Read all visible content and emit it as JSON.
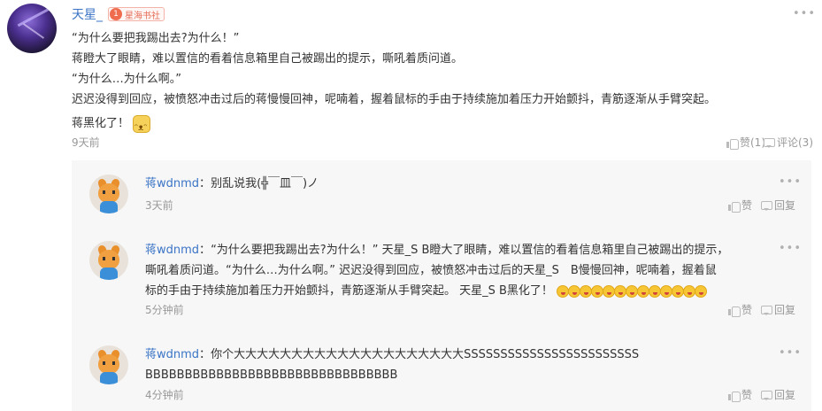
{
  "post": {
    "user_name": "天星_",
    "group_badge_num": "1",
    "group_badge_label": "星海书社",
    "lines": [
      "“为什么要把我踢出去?为什么！”",
      "蒋瞪大了眼睛，难以置信的看着信息箱里自己被踢出的提示，嘶吼着质问道。",
      "“为什么…为什么啊。”",
      "迟迟没得到回应，被愤怒冲击过后的蒋慢慢回神，呢喃着，握着鼠标的手由于持续施加着压力开始颤抖，青筋逐渐从手臂突起。",
      "蒋黑化了！"
    ],
    "time": "9天前",
    "like_label": "赞(1)",
    "comment_label": "评论(3)",
    "more_label": "•••"
  },
  "replies": [
    {
      "name": "蒋wdnmd",
      "lines": [
        "别乱说我(╬￣皿￣)ノ"
      ],
      "time": "3天前",
      "like_label": "赞",
      "reply_label": "回复",
      "more_label": "•••"
    },
    {
      "name": "蒋wdnmd",
      "lines": [
        "“为什么要把我踢出去?为什么！” 天星_S B瞪大了眼睛，难以置信的看着信息箱里自己被踢出的提示，",
        "嘶吼着质问道。“为什么…为什么啊。” 迟迟没得到回应，被愤怒冲击过后的天星_S　B慢慢回神，呢喃着，握着鼠",
        "标的手由于持续施加着压力开始颤抖，青筋逐渐从手臂突起。 天星_S B黑化了！"
      ],
      "emoji_count": 13,
      "time": "5分钟前",
      "like_label": "赞",
      "reply_label": "回复",
      "more_label": "•••"
    },
    {
      "name": "蒋wdnmd",
      "lines": [
        "你个大大大大大大大大大大大大大大大大大大大大SSSSSSSSSSSSSSSSSSSSSSSS",
        "BBBBBBBBBBBBBBBBBBBBBBBBBBBBBBBB"
      ],
      "time": "4分钟前",
      "like_label": "赞",
      "reply_label": "回复",
      "more_label": "•••"
    }
  ],
  "colors": {
    "link": "#3b74c6",
    "muted": "#999999",
    "panel": "#f7f7f7"
  }
}
